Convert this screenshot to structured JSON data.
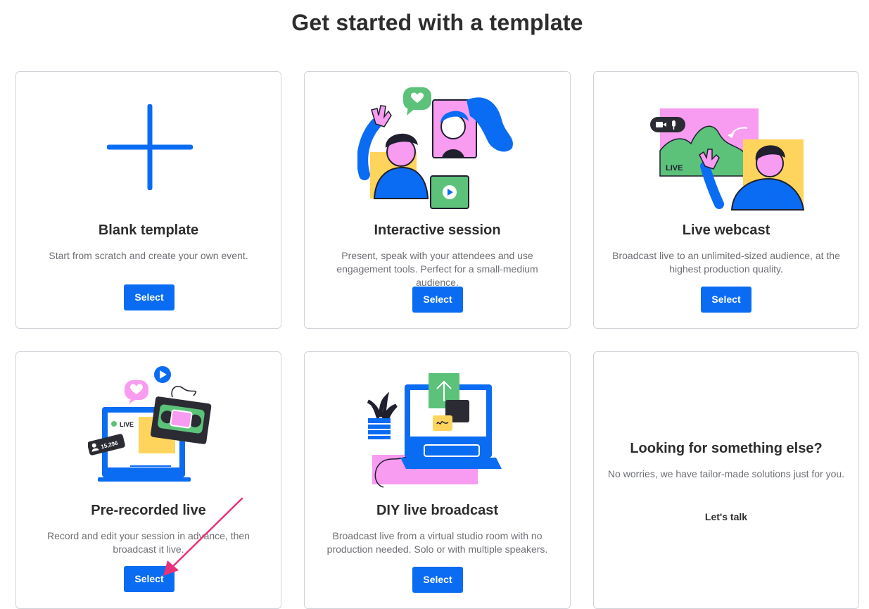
{
  "page": {
    "title": "Get started with a template"
  },
  "cards": [
    {
      "title": "Blank template",
      "description": "Start from scratch and create your own event.",
      "button": "Select",
      "illustration": "plus-icon"
    },
    {
      "title": "Interactive session",
      "description": "Present, speak with your attendees and use engagement tools. Perfect for a small-medium audience.",
      "button": "Select",
      "illustration": "interactive-session-illustration"
    },
    {
      "title": "Live webcast",
      "description": "Broadcast live to an unlimited-sized audience, at the highest production quality.",
      "button": "Select",
      "illustration": "live-webcast-illustration",
      "live_label": "LIVE"
    },
    {
      "title": "Pre-recorded live",
      "description": "Record and edit your session in advance, then broadcast it live.",
      "button": "Select",
      "illustration": "pre-recorded-illustration",
      "live_label": "LIVE",
      "viewer_count": "15,296"
    },
    {
      "title": "DIY live broadcast",
      "description": "Broadcast live from a virtual studio room with no production needed. Solo or with multiple speakers.",
      "button": "Select",
      "illustration": "diy-broadcast-illustration"
    },
    {
      "title": "Looking for something else?",
      "description": "No worries, we have tailor-made solutions just for you.",
      "button": "Let's talk"
    }
  ],
  "colors": {
    "primary": "#0a6cf2",
    "pink": "#f79cf0",
    "green": "#5cc27a",
    "yellow": "#ffd45c",
    "annotation_arrow": "#e8317a"
  }
}
